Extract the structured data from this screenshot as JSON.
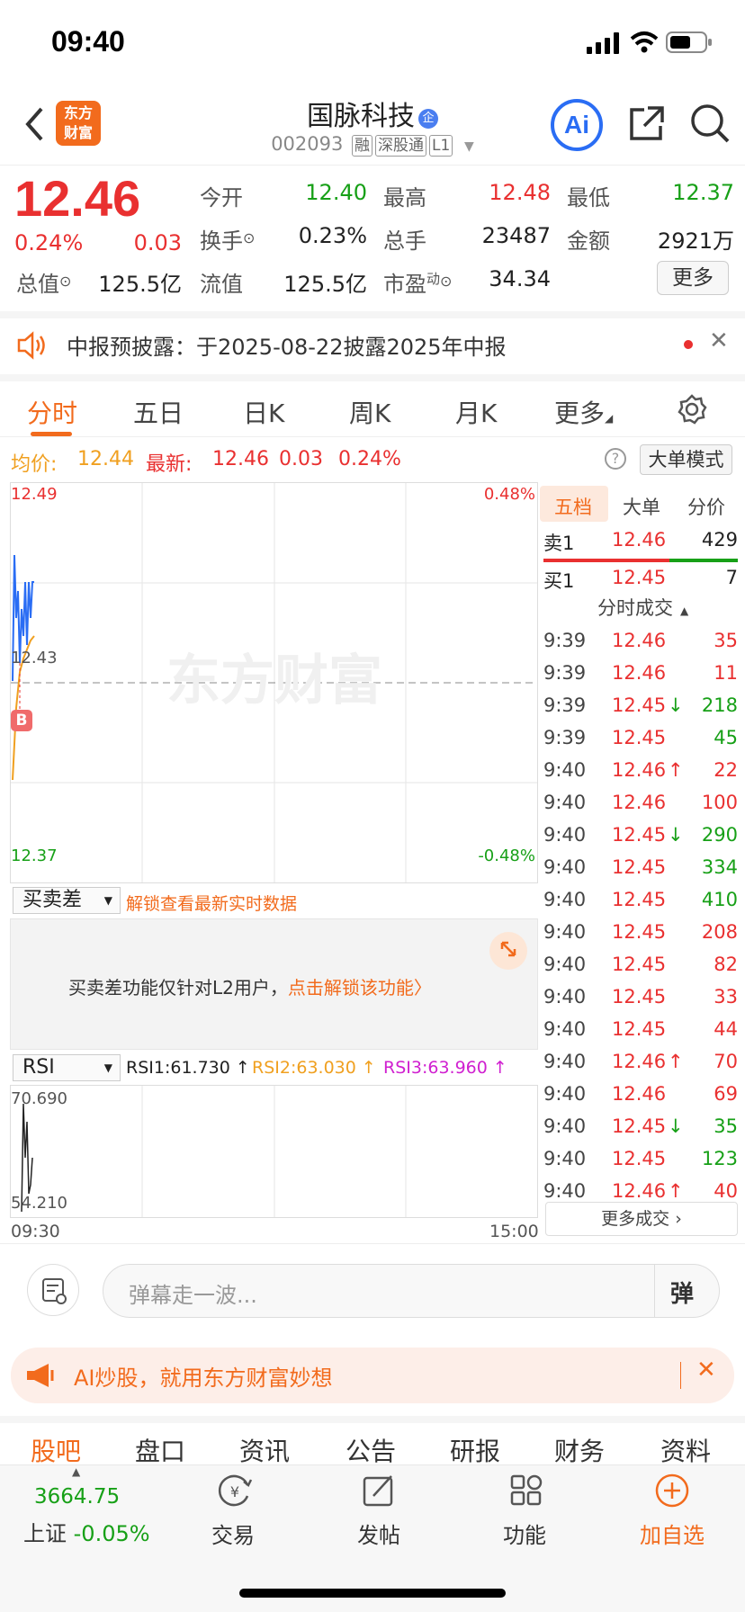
{
  "status": {
    "time": "09:40"
  },
  "header": {
    "logo_top": "东方",
    "logo_bottom": "财富",
    "stock_name": "国脉科技",
    "stock_code": "002093",
    "tags": [
      "融",
      "深股通",
      "L1"
    ],
    "ai_label": "Ai"
  },
  "quote": {
    "price": "12.46",
    "change_pct": "0.24%",
    "change": "0.03",
    "open_label": "今开",
    "open": "12.40",
    "high_label": "最高",
    "high": "12.48",
    "low_label": "最低",
    "low": "12.37",
    "turnover_label": "换手",
    "turnover": "0.23%",
    "volume_label": "总手",
    "volume": "23487",
    "amount_label": "金额",
    "amount": "2921万",
    "mktcap_label": "总值",
    "mktcap": "125.5亿",
    "float_label": "流值",
    "float_cap": "125.5亿",
    "pe_label": "市盈",
    "pe_sup": "动",
    "pe": "34.34",
    "more": "更多"
  },
  "notice": {
    "text": "中报预披露：于2025-08-22披露2025年中报"
  },
  "ktabs": [
    "分时",
    "五日",
    "日K",
    "周K",
    "月K",
    "更多"
  ],
  "info": {
    "avg_label": "均价:",
    "avg": "12.44",
    "latest_label": "最新:",
    "latest": "12.46",
    "chg": "0.03",
    "pct": "0.24%",
    "mode": "大单模式"
  },
  "chart_data": {
    "type": "line",
    "y_top": "12.49",
    "y_mid": "12.43",
    "y_bottom": "12.37",
    "pct_top": "0.48%",
    "pct_bottom": "-0.48%",
    "ylim": [
      12.37,
      12.49
    ],
    "series": [],
    "watermark": "东方财富",
    "marker": "B"
  },
  "orderbook": {
    "tabs": [
      "五档",
      "大单",
      "分价"
    ],
    "sell1": {
      "label": "卖1",
      "price": "12.46",
      "vol": "429"
    },
    "buy1": {
      "label": "买1",
      "price": "12.45",
      "vol": "7"
    },
    "ticks_title": "分时成交",
    "ticks": [
      {
        "t": "9:39",
        "p": "12.46",
        "a": "",
        "v": "35",
        "c": "red",
        "vc": "red"
      },
      {
        "t": "9:39",
        "p": "12.46",
        "a": "",
        "v": "11",
        "c": "red",
        "vc": "red"
      },
      {
        "t": "9:39",
        "p": "12.45",
        "a": "↓",
        "v": "218",
        "c": "red",
        "vc": "green"
      },
      {
        "t": "9:39",
        "p": "12.45",
        "a": "",
        "v": "45",
        "c": "red",
        "vc": "green"
      },
      {
        "t": "9:40",
        "p": "12.46",
        "a": "↑",
        "v": "22",
        "c": "red",
        "vc": "red"
      },
      {
        "t": "9:40",
        "p": "12.46",
        "a": "",
        "v": "100",
        "c": "red",
        "vc": "red"
      },
      {
        "t": "9:40",
        "p": "12.45",
        "a": "↓",
        "v": "290",
        "c": "red",
        "vc": "green"
      },
      {
        "t": "9:40",
        "p": "12.45",
        "a": "",
        "v": "334",
        "c": "red",
        "vc": "green"
      },
      {
        "t": "9:40",
        "p": "12.45",
        "a": "",
        "v": "410",
        "c": "red",
        "vc": "green"
      },
      {
        "t": "9:40",
        "p": "12.45",
        "a": "",
        "v": "208",
        "c": "red",
        "vc": "red"
      },
      {
        "t": "9:40",
        "p": "12.45",
        "a": "",
        "v": "82",
        "c": "red",
        "vc": "red"
      },
      {
        "t": "9:40",
        "p": "12.45",
        "a": "",
        "v": "33",
        "c": "red",
        "vc": "red"
      },
      {
        "t": "9:40",
        "p": "12.45",
        "a": "",
        "v": "44",
        "c": "red",
        "vc": "red"
      },
      {
        "t": "9:40",
        "p": "12.46",
        "a": "↑",
        "v": "70",
        "c": "red",
        "vc": "red"
      },
      {
        "t": "9:40",
        "p": "12.46",
        "a": "",
        "v": "69",
        "c": "red",
        "vc": "red"
      },
      {
        "t": "9:40",
        "p": "12.45",
        "a": "↓",
        "v": "35",
        "c": "red",
        "vc": "green"
      },
      {
        "t": "9:40",
        "p": "12.45",
        "a": "",
        "v": "123",
        "c": "red",
        "vc": "green"
      },
      {
        "t": "9:40",
        "p": "12.46",
        "a": "↑",
        "v": "40",
        "c": "red",
        "vc": "red"
      }
    ],
    "more_ticks": "更多成交"
  },
  "indicator1": {
    "select": "买卖差",
    "unlock": "解锁查看最新实时数据",
    "msg": "买卖差功能仅针对L2用户，",
    "link": "点击解锁该功能"
  },
  "indicator2": {
    "select": "RSI",
    "rsi1": "RSI1:61.730 ↑",
    "rsi2": "RSI2:63.030 ↑",
    "rsi3": "RSI3:63.960 ↑",
    "y_top": "70.690",
    "y_bottom": "54.210",
    "x_start": "09:30",
    "x_end": "15:00"
  },
  "comment": {
    "placeholder": "弹幕走一波...",
    "danmu": "弹"
  },
  "ai_banner": {
    "text": "AI炒股，就用东方财富妙想"
  },
  "btabs": [
    "股吧",
    "盘口",
    "资讯",
    "公告",
    "研报",
    "财务",
    "资料"
  ],
  "nav": {
    "index_value": "3664.75",
    "index_name": "上证",
    "index_pct": "-0.05%",
    "items": [
      "交易",
      "发帖",
      "功能",
      "加自选"
    ]
  }
}
